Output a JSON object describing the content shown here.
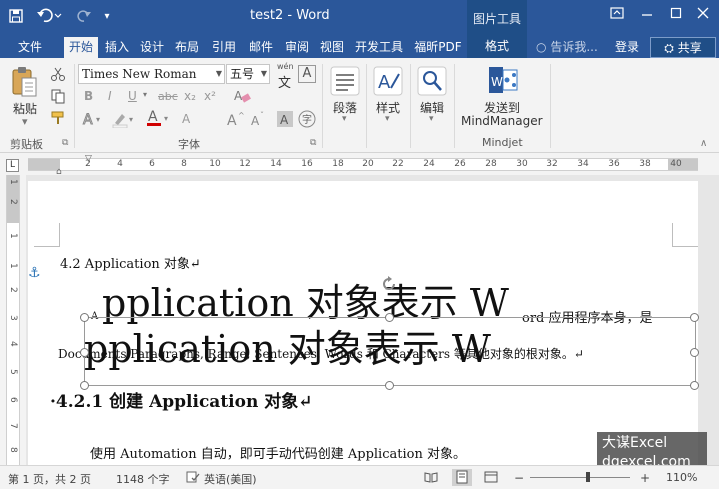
{
  "app": {
    "doc_title": "test2 - Word",
    "context_tools": "图片工具"
  },
  "tabs": [
    "文件",
    "开始",
    "插入",
    "设计",
    "布局",
    "引用",
    "邮件",
    "审阅",
    "视图",
    "开发工具",
    "福昕PDF",
    "格式"
  ],
  "tell_me": "告诉我...",
  "login": "登录",
  "share": "共享",
  "ribbon": {
    "clipboard": {
      "paste": "粘贴",
      "label": "剪贴板"
    },
    "font": {
      "label": "字体",
      "font_name": "Times New Roman",
      "font_size": "五号",
      "wen_top": "wén",
      "wen_char": "文",
      "a_char": "A",
      "bold": "B",
      "italic": "I",
      "underline": "U",
      "strike": "abc",
      "subscript": "x₂",
      "superscript": "x²",
      "font_color": "A"
    },
    "paragraph": {
      "label": "段落"
    },
    "styles": {
      "label": "样式"
    },
    "editing": {
      "label": "编辑"
    },
    "mindjet": {
      "send1": "发送到",
      "send2": "MindManager",
      "label": "Mindjet"
    }
  },
  "ruler": {
    "corner": "L",
    "numbers": [
      "2",
      "4",
      "6",
      "8",
      "10",
      "12",
      "14",
      "16",
      "18",
      "20",
      "22",
      "24",
      "26",
      "28",
      "30",
      "32",
      "34",
      "36",
      "38",
      "40"
    ]
  },
  "vruler": {
    "numbers": [
      "1",
      "2",
      "1",
      "1",
      "2",
      "3",
      "4",
      "5",
      "6",
      "7",
      "8"
    ]
  },
  "doc": {
    "heading1": "4.2 Application  对象↵",
    "drop_cap_small": "A",
    "big_line1": "pplication 对象表示 W",
    "big_line1_tail": "ord 应用程序本身，是",
    "big_line2": "pplication 对象表示 W",
    "under_text": "Documents,Paragraphs, Range, Sentences, Words 和 Characters 等其他对象的根对象。↵",
    "heading2": "·4.2.1  创建 Application 对象↵",
    "body_partial": "使用 Automation 自动，即可手动代码创建 Application 对象。"
  },
  "status": {
    "pages": "第 1 页，共 2 页",
    "words": "1148 个字",
    "lang": "英语(美国)",
    "zoom": "110%"
  },
  "watermark": {
    "line1": "大谋Excel",
    "line2": "dqexcel.com"
  },
  "colors": {
    "accent": "#2b579a",
    "accent_dark": "#1f4e87",
    "font_red": "#d00000",
    "anchor": "#2e75b6"
  }
}
